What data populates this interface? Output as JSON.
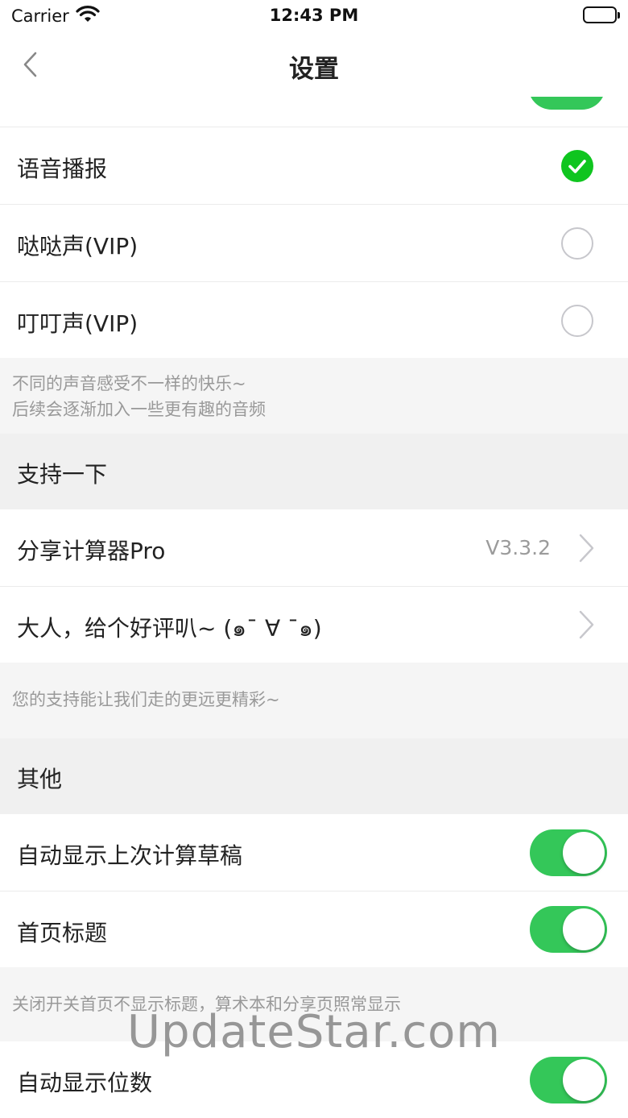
{
  "status_bar": {
    "carrier": "Carrier",
    "time": "12:43 PM",
    "wifi_icon": "wifi-icon",
    "battery_icon": "battery-icon"
  },
  "nav": {
    "title": "设置",
    "back_icon": "chevron-left-icon"
  },
  "sound_options": [
    {
      "label": "语音播报",
      "selected": true
    },
    {
      "label": "哒哒声(VIP)",
      "selected": false
    },
    {
      "label": "叮叮声(VIP)",
      "selected": false
    }
  ],
  "sound_footer": {
    "line1": "不同的声音感受不一样的快乐~",
    "line2": "后续会逐渐加入一些更有趣的音频"
  },
  "support_section": {
    "header": "支持一下",
    "share_label": "分享计算器Pro",
    "version": "V3.3.2",
    "rate_label": "大人，给个好评叭~ (๑¯ ∀ ¯๑)",
    "footer": "您的支持能让我们走的更远更精彩~"
  },
  "other_section": {
    "header": "其他",
    "auto_draft_label": "自动显示上次计算草稿",
    "home_title_label": "首页标题",
    "footer": "关闭开关首页不显示标题，算术本和分享页照常显示",
    "auto_digits_label": "自动显示位数"
  },
  "toggles": {
    "auto_draft": true,
    "home_title": true,
    "auto_digits": true
  },
  "watermark": "UpdateStar.com",
  "colors": {
    "accent_green": "#34c759",
    "check_green": "#0fc51f",
    "section_bg": "#f0f0f0",
    "footer_text": "#999999"
  }
}
